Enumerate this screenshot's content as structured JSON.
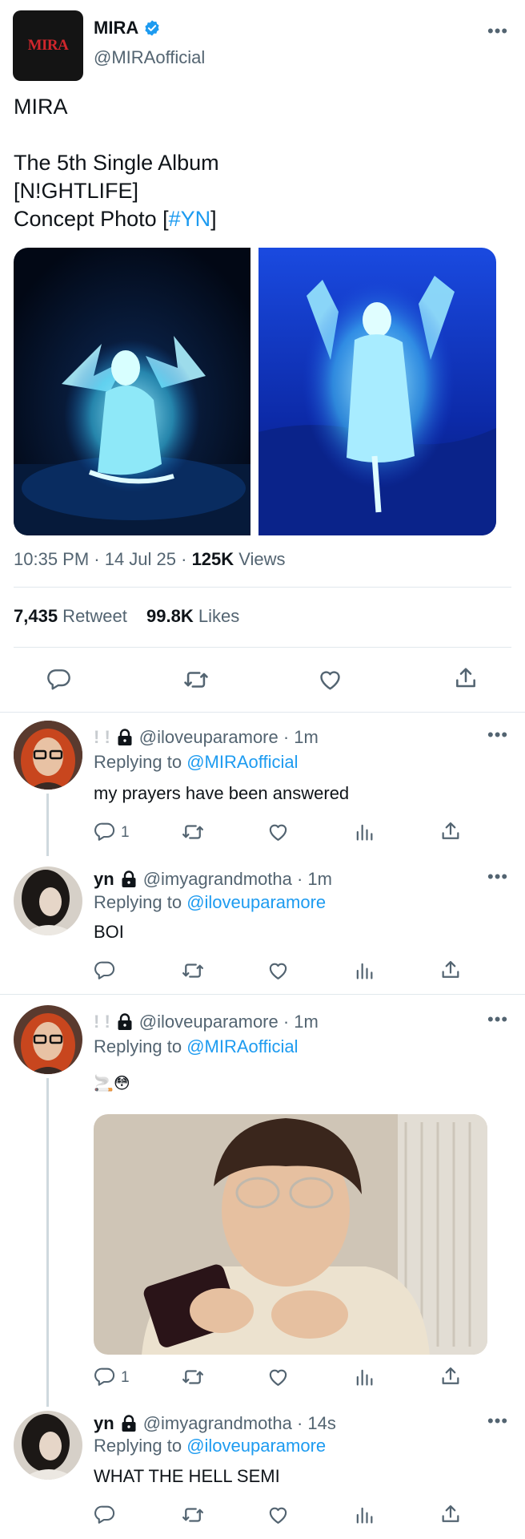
{
  "main_tweet": {
    "display_name": "MIRA",
    "handle": "@MIRAofficial",
    "avatar_text": "MIRA",
    "text_line1": "MIRA",
    "text_line2": "The 5th Single Album",
    "text_line3": "[N!GHTLIFE]",
    "text_line4_prefix": "Concept Photo [",
    "hashtag": "#YN",
    "text_line4_suffix": "]",
    "time": "10:35 PM · 14 Jul 25 · ",
    "views_count": "125K",
    "views_label": " Views",
    "retweet_count": "7,435",
    "retweet_label": " Retweet",
    "likes_count": "99.8K",
    "likes_label": " Likes"
  },
  "replies": [
    {
      "display_name": "! !",
      "handle": "@iloveuparamore · 1m",
      "replying_prefix": "Replying to ",
      "replying_to": "@MIRAofficial",
      "text": "my prayers have been answered",
      "reply_count": "1"
    },
    {
      "display_name": "yn",
      "handle": "@imyagrandmotha · 1m",
      "replying_prefix": "Replying to ",
      "replying_to": "@iloveuparamore",
      "text": "BOI",
      "reply_count": ""
    },
    {
      "display_name": "! !",
      "handle": "@iloveuparamore · 1m",
      "replying_prefix": "Replying to ",
      "replying_to": "@MIRAofficial",
      "text": "🚬😳",
      "reply_count": "1"
    },
    {
      "display_name": "yn",
      "handle": "@imyagrandmotha · 14s",
      "replying_prefix": "Replying to ",
      "replying_to": "@iloveuparamore",
      "text": "WHAT THE HELL SEMI",
      "reply_count": ""
    }
  ],
  "colors": {
    "accent": "#1d9bf0",
    "secondary_text": "#536471",
    "divider": "#e1e8ed",
    "avatar_bg": "#141414",
    "avatar_text": "#d0262c"
  },
  "icons": [
    "verified-badge-icon",
    "more-icon",
    "reply-icon",
    "retweet-icon",
    "like-icon",
    "views-icon",
    "share-icon",
    "lock-icon"
  ]
}
